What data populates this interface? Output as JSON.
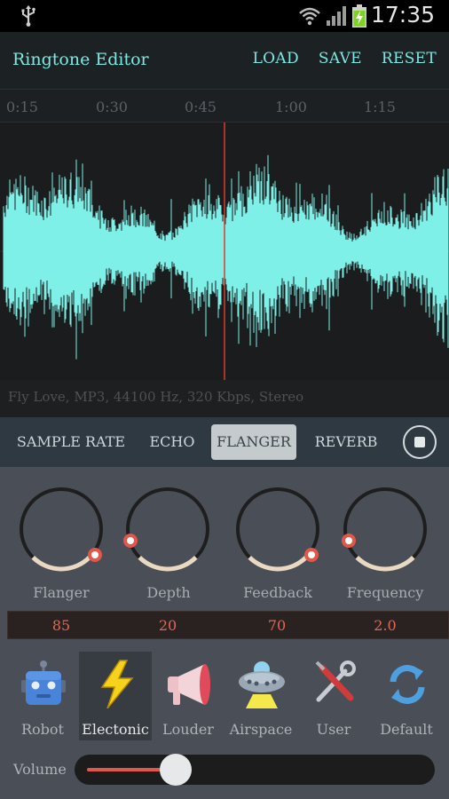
{
  "status_bar": {
    "time": "17:35",
    "icons": [
      "usb-icon",
      "wifi-icon",
      "signal-icon",
      "battery-charging-icon"
    ]
  },
  "app_bar": {
    "title": "Ringtone Editor",
    "actions": [
      "LOAD",
      "SAVE",
      "RESET"
    ]
  },
  "timeline": {
    "ticks": [
      "0:15",
      "0:30",
      "0:45",
      "1:00",
      "1:15"
    ]
  },
  "waveform": {
    "color": "#7ff0e8",
    "playhead_color": "#d83a32"
  },
  "file_info": "Fly Love, MP3, 44100 Hz, 320 Kbps, Stereo",
  "effect_tabs": {
    "items": [
      "SAMPLE RATE",
      "ECHO",
      "FLANGER",
      "REVERB"
    ],
    "active": "FLANGER",
    "stop_icon": "stop-icon"
  },
  "knobs": [
    {
      "label": "Flanger",
      "value": "85"
    },
    {
      "label": "Depth",
      "value": "20"
    },
    {
      "label": "Feedback",
      "value": "70"
    },
    {
      "label": "Frequency",
      "value": "2.0"
    }
  ],
  "presets": {
    "items": [
      {
        "label": "Robot",
        "icon": "robot-icon"
      },
      {
        "label": "Electonic",
        "icon": "lightning-icon"
      },
      {
        "label": "Louder",
        "icon": "megaphone-icon"
      },
      {
        "label": "Airspace",
        "icon": "ufo-icon"
      },
      {
        "label": "User",
        "icon": "tools-icon"
      },
      {
        "label": "Default",
        "icon": "refresh-icon"
      }
    ],
    "active": "Electonic"
  },
  "volume": {
    "label": "Volume",
    "level": 0.26
  },
  "colors": {
    "accent": "#7fe8e2",
    "value_text": "#e26754",
    "knob_track": "#1e1e1f",
    "knob_arc": "#ead9c2",
    "knob_handle": "#e2574a"
  }
}
